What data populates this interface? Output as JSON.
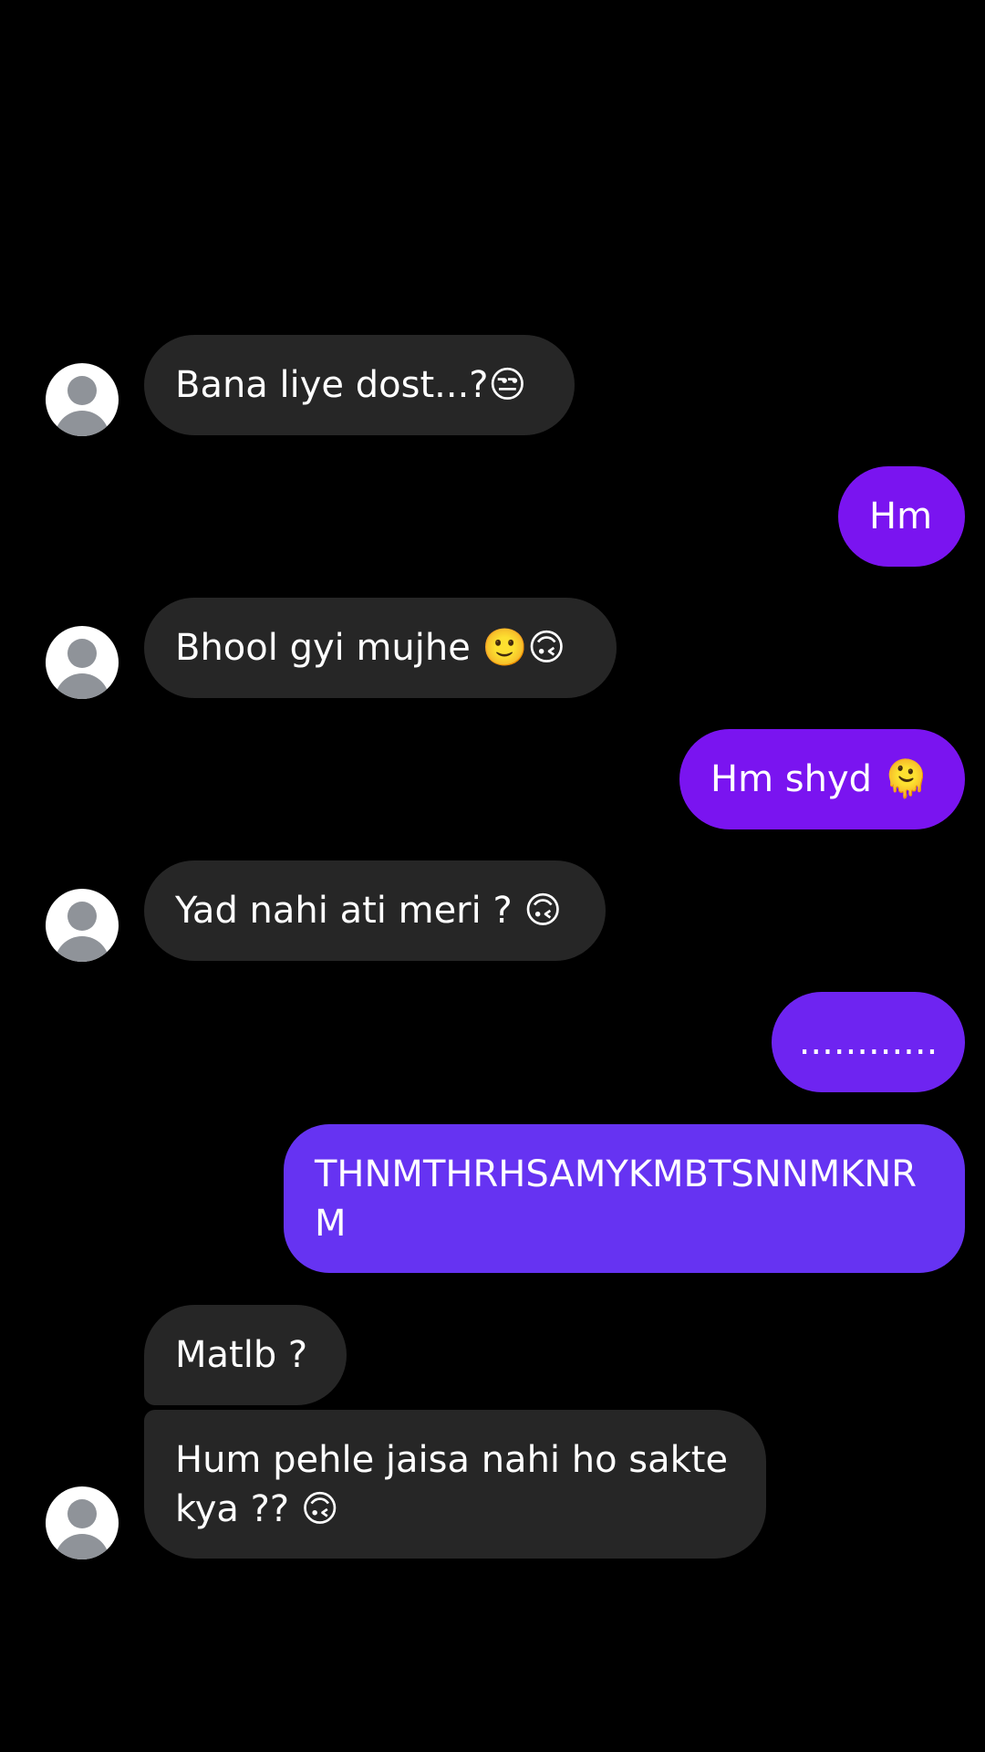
{
  "colors": {
    "background": "#000000",
    "incoming_bubble": "#262626",
    "outgoing_violet": "#7a14f0",
    "outgoing_indigo": "#6633f2",
    "avatar_fill": "#8f9399"
  },
  "messages": [
    {
      "direction": "in",
      "text": "Bana liye dost...?😒"
    },
    {
      "direction": "out",
      "text": "Hm"
    },
    {
      "direction": "in",
      "text": "Bhool gyi mujhe 🙂🙃"
    },
    {
      "direction": "out",
      "text": "Hm shyd 🫠"
    },
    {
      "direction": "in",
      "text": "Yad nahi ati meri ? 🙃"
    },
    {
      "direction": "out",
      "text": "............"
    },
    {
      "direction": "out",
      "text": "THNMTHRHSAMYKMBTSNNMKNRM"
    },
    {
      "direction": "in",
      "text": "Matlb ?"
    },
    {
      "direction": "in",
      "text": "Hum pehle jaisa nahi ho sakte kya ?? 🙃"
    }
  ],
  "avatar_icon": "default-user-avatar-icon"
}
